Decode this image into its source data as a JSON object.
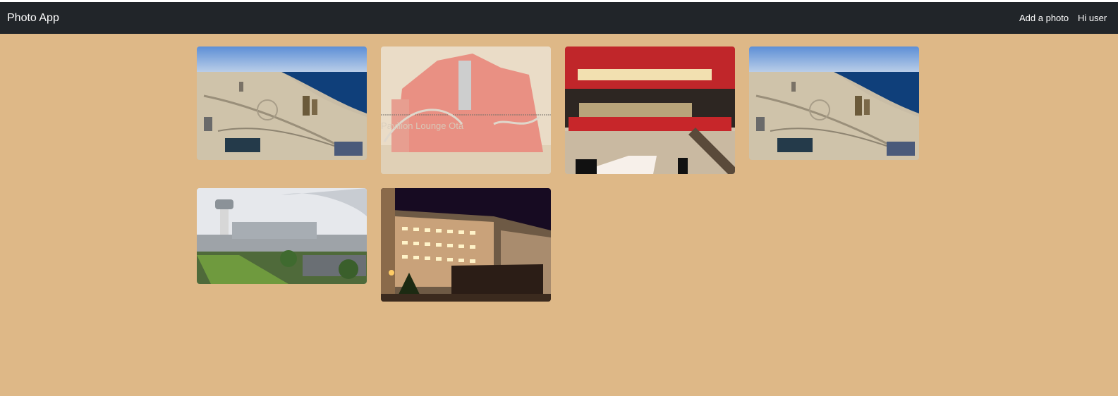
{
  "navbar": {
    "brand": "Photo App",
    "links": [
      {
        "label": "Add a photo"
      },
      {
        "label": "Hi user"
      }
    ]
  },
  "colors": {
    "page_background": "#deb887",
    "navbar_background": "#212529",
    "navbar_text": "#ffffff"
  },
  "gallery": {
    "photos": [
      {
        "subject": "aerial view of coastline with construction site"
      },
      {
        "subject": "red building facade with faded overlay",
        "overlay_text": "Pavilion Lounge Ota"
      },
      {
        "subject": "fast-food restaurant interior with red counter"
      },
      {
        "subject": "aerial view of coastline with construction site"
      },
      {
        "subject": "airport terminal with control tower"
      },
      {
        "subject": "hotel building lit at night"
      }
    ]
  }
}
